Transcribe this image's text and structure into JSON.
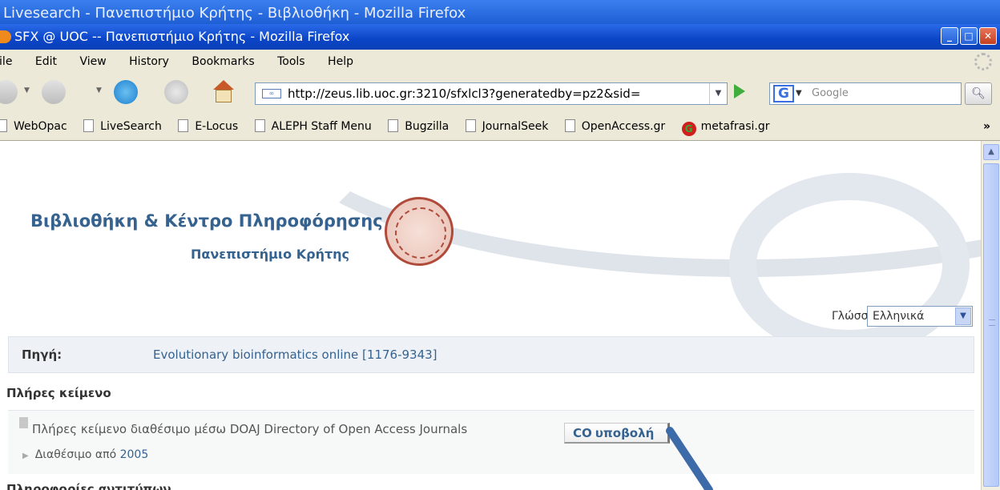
{
  "background_window": {
    "title": "Livesearch - Πανεπιστήμιο Κρήτης - Βιβλιοθήκη - Mozilla Firefox"
  },
  "window": {
    "title": "SFX @ UOC -- Πανεπιστήμιο Κρήτης - Mozilla Firefox"
  },
  "menu": [
    "File",
    "Edit",
    "View",
    "History",
    "Bookmarks",
    "Tools",
    "Help"
  ],
  "address": {
    "url": "http://zeus.lib.uoc.gr:3210/sfxlcl3?generatedby=pz2&sid=",
    "search_placeholder": "Google"
  },
  "bookmarks": [
    "WebOpac",
    "LiveSearch",
    "E-Locus",
    "ALEPH Staff Menu",
    "Bugzilla",
    "JournalSeek",
    "OpenAccess.gr",
    "metafrasi.gr"
  ],
  "bookmarks_more": "»",
  "page": {
    "library_title": "Βιβλιοθήκη & Κέντρο Πληροφόρησης",
    "university": "Πανεπιστήμιο Κρήτης",
    "language_label": "Γλώσσα",
    "language_value": "Ελληνικά",
    "source_label": "Πηγή:",
    "source_value": "Evolutionary bioinformatics online [1176-9343]",
    "fulltext_heading": "Πλήρες κείμενο",
    "fulltext_desc": "Πλήρες κείμενο διαθέσιμο μέσω DOAJ Directory of Open Access Journals",
    "submit_label": "υποβολή",
    "available_from": "Διαθέσιμο από",
    "available_year": "2005",
    "next_heading": "Πληροφορίες αντιτύπων"
  }
}
